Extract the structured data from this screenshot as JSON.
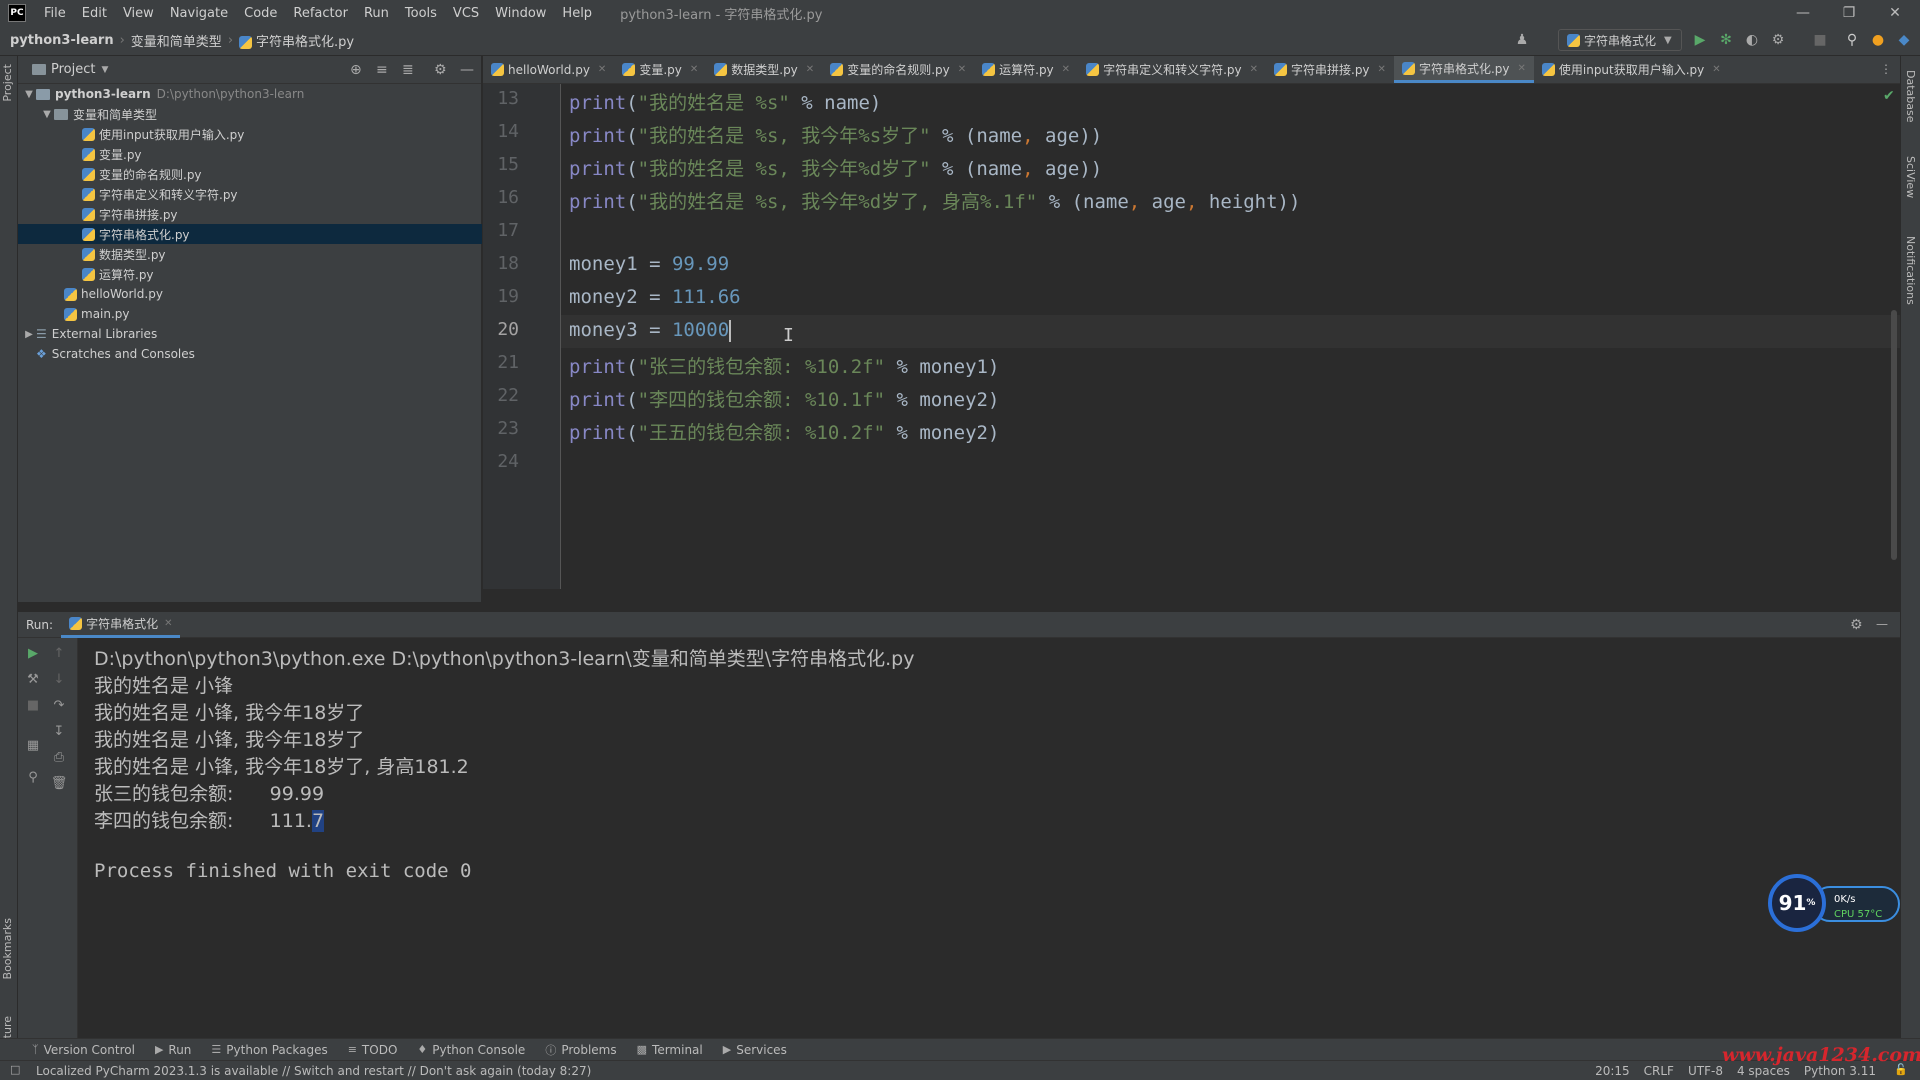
{
  "menubar": {
    "logo": "PC",
    "items": [
      "File",
      "Edit",
      "View",
      "Navigate",
      "Code",
      "Refactor",
      "Run",
      "Tools",
      "VCS",
      "Window",
      "Help"
    ],
    "title": "python3-learn - 字符串格式化.py"
  },
  "navbar": {
    "project": "python3-learn",
    "folder": "变量和简单类型",
    "file": "字符串格式化.py",
    "run_config": "字符串格式化"
  },
  "project_panel": {
    "title": "Project",
    "root_name": "python3-learn",
    "root_path": "D:\\python\\python3-learn",
    "folder": "变量和简单类型",
    "files": [
      "使用input获取用户输入.py",
      "变量.py",
      "变量的命名规则.py",
      "字符串定义和转义字符.py",
      "字符串拼接.py",
      "字符串格式化.py",
      "数据类型.py",
      "运算符.py"
    ],
    "selected_file": "字符串格式化.py",
    "root_files": [
      "helloWorld.py",
      "main.py"
    ],
    "external_libraries": "External Libraries",
    "scratches": "Scratches and Consoles"
  },
  "tabs": [
    "helloWorld.py",
    "变量.py",
    "数据类型.py",
    "变量的命名规则.py",
    "运算符.py",
    "字符串定义和转义字符.py",
    "字符串拼接.py",
    "字符串格式化.py",
    "使用input获取用户输入.py"
  ],
  "active_tab": "字符串格式化.py",
  "editor": {
    "current_line": "20",
    "lines": [
      {
        "n": "13",
        "a": "print(",
        "s": "\"我的姓名是 %s\"",
        "b": " % name)"
      },
      {
        "n": "14",
        "a": "print(",
        "s": "\"我的姓名是 %s, 我今年%s岁了\"",
        "b": " % (name, age))"
      },
      {
        "n": "15",
        "a": "print(",
        "s": "\"我的姓名是 %s, 我今年%d岁了\"",
        "b": " % (name, age))"
      },
      {
        "n": "16",
        "a": "print(",
        "s": "\"我的姓名是 %s, 我今年%d岁了, 身高%.1f\"",
        "b": " % (name, age, height))"
      },
      {
        "n": "17",
        "a": "",
        "s": "",
        "b": ""
      },
      {
        "n": "18",
        "a": "money1 = ",
        "s": "",
        "b": "",
        "num": "99.99"
      },
      {
        "n": "19",
        "a": "money2 = ",
        "s": "",
        "b": "",
        "num": "111.66"
      },
      {
        "n": "20",
        "a": "money3 = ",
        "s": "",
        "b": "",
        "num": "10000"
      },
      {
        "n": "21",
        "a": "print(",
        "s": "\"张三的钱包余额: %10.2f\"",
        "b": " % money1)"
      },
      {
        "n": "22",
        "a": "print(",
        "s": "\"李四的钱包余额: %10.1f\"",
        "b": " % money2)"
      },
      {
        "n": "23",
        "a": "print(",
        "s": "\"王五的钱包余额: %10.2f\"",
        "b": " % money2)"
      },
      {
        "n": "24",
        "a": "",
        "s": "",
        "b": ""
      }
    ]
  },
  "run": {
    "label": "Run:",
    "tab": "字符串格式化",
    "command": "D:\\python\\python3\\python.exe D:\\python\\python3-learn\\变量和简单类型\\字符串格式化.py",
    "output": [
      "我的姓名是 小锋",
      "我的姓名是 小锋, 我今年18岁了",
      "我的姓名是 小锋, 我今年18岁了",
      "我的姓名是 小锋, 我今年18岁了, 身高181.2",
      "张三的钱包余额:      99.99"
    ],
    "last_prefix": "李四的钱包余额:      111.",
    "last_selected": "7",
    "exit": "Process finished with exit code 0"
  },
  "bottom_tools": [
    "Version Control",
    "Run",
    "Python Packages",
    "TODO",
    "Python Console",
    "Problems",
    "Terminal",
    "Services"
  ],
  "status": {
    "message": "Localized PyCharm 2023.1.3 is available // Switch and restart // Don't ask again (today 8:27)",
    "position": "20:15",
    "line_sep": "CRLF",
    "encoding": "UTF-8",
    "indent": "4 spaces",
    "interpreter": "Python 3.11"
  },
  "side_labels": {
    "project": "Project",
    "bookmarks": "Bookmarks",
    "structure": "Structure",
    "database": "Database",
    "sciview": "SciView",
    "notifications": "Notifications"
  },
  "cpu_widget": {
    "value": "91",
    "unit": "%",
    "net": "0K/s",
    "cpu": "CPU 57°C"
  },
  "watermark": "www.java1234.com"
}
